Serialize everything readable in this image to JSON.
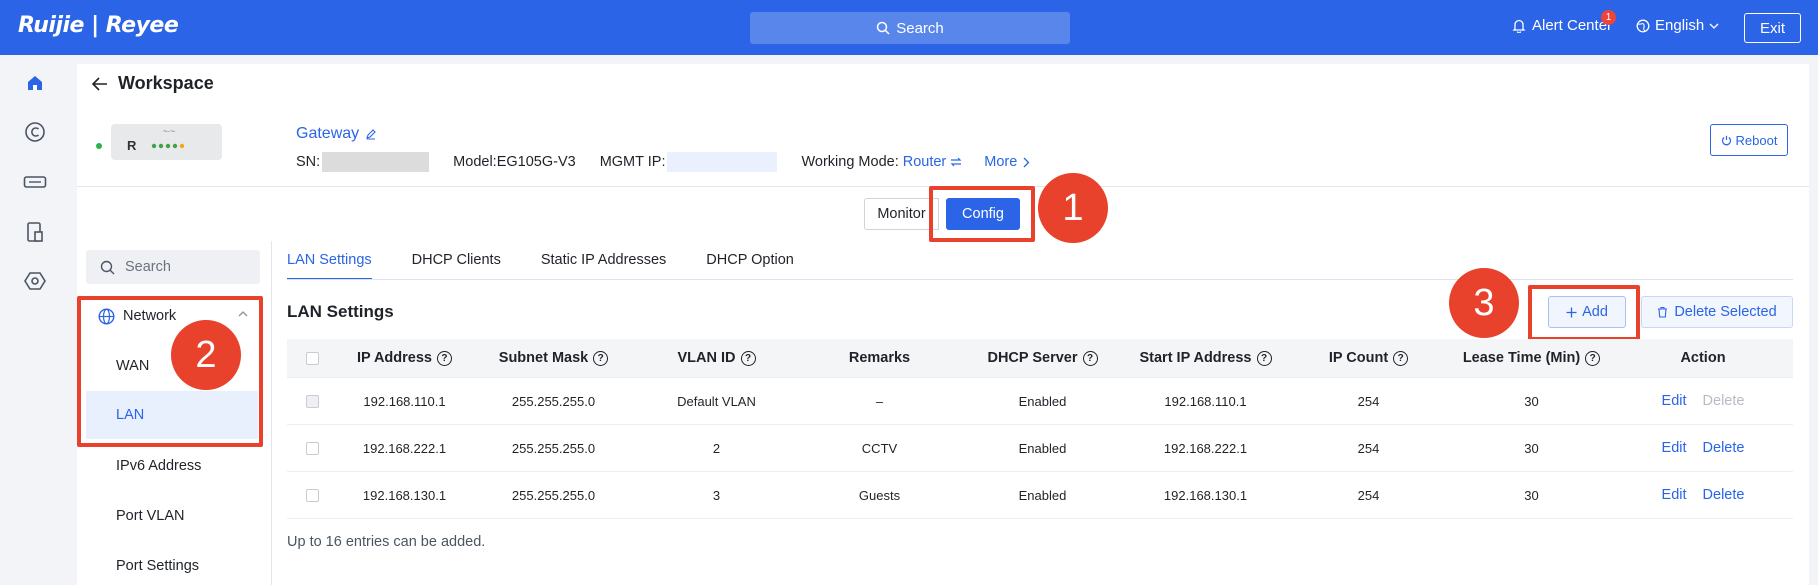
{
  "topbar": {
    "logo": "Ruijie | Reyee",
    "search_label": "Search",
    "alert_label": "Alert Center",
    "alert_count": "1",
    "language": "English",
    "exit_label": "Exit"
  },
  "colors": {
    "brand": "#2b64e6",
    "annotation": "#e8412c",
    "online": "#2bb24c"
  },
  "icons": {
    "sidebar": [
      "home-icon",
      "cloud-c-icon",
      "device-icon",
      "clipboard-icon",
      "hexagon-settings-icon"
    ]
  },
  "workspace": {
    "title": "Workspace"
  },
  "device": {
    "name": "Gateway",
    "sn_label": "SN:",
    "model": "Model:EG105G-V3",
    "mgmt_label": "MGMT IP:",
    "working_mode_label": "Working Mode:",
    "working_mode_value": "Router",
    "more_label": "More",
    "reboot_label": "Reboot",
    "panel_letter": "R"
  },
  "mode_toggle": {
    "monitor": "Monitor",
    "config": "Config"
  },
  "annotations": {
    "m1": "1",
    "m2": "2",
    "m3": "3"
  },
  "sidebar": {
    "search_placeholder": "Search",
    "group_label": "Network",
    "items": [
      {
        "label": "WAN"
      },
      {
        "label": "LAN"
      },
      {
        "label": "IPv6 Address"
      },
      {
        "label": "Port VLAN"
      },
      {
        "label": "Port Settings"
      }
    ]
  },
  "tabs": [
    "LAN Settings",
    "DHCP Clients",
    "Static IP Addresses",
    "DHCP Option"
  ],
  "section": {
    "title": "LAN Settings",
    "add_label": "Add",
    "delete_selected_label": "Delete Selected",
    "footnote": "Up to 16 entries can be added."
  },
  "table": {
    "headers": [
      "IP Address",
      "Subnet Mask",
      "VLAN ID",
      "Remarks",
      "DHCP Server",
      "Start IP Address",
      "IP Count",
      "Lease Time (Min)",
      "Action"
    ],
    "rows": [
      {
        "ip": "192.168.110.1",
        "mask": "255.255.255.0",
        "vlan": "Default VLAN",
        "remarks": "–",
        "dhcp": "Enabled",
        "start": "192.168.110.1",
        "count": "254",
        "lease": "30",
        "edit": "Edit",
        "delete": "Delete"
      },
      {
        "ip": "192.168.222.1",
        "mask": "255.255.255.0",
        "vlan": "2",
        "remarks": "CCTV",
        "dhcp": "Enabled",
        "start": "192.168.222.1",
        "count": "254",
        "lease": "30",
        "edit": "Edit",
        "delete": "Delete"
      },
      {
        "ip": "192.168.130.1",
        "mask": "255.255.255.0",
        "vlan": "3",
        "remarks": "Guests",
        "dhcp": "Enabled",
        "start": "192.168.130.1",
        "count": "254",
        "lease": "30",
        "edit": "Edit",
        "delete": "Delete"
      }
    ]
  }
}
